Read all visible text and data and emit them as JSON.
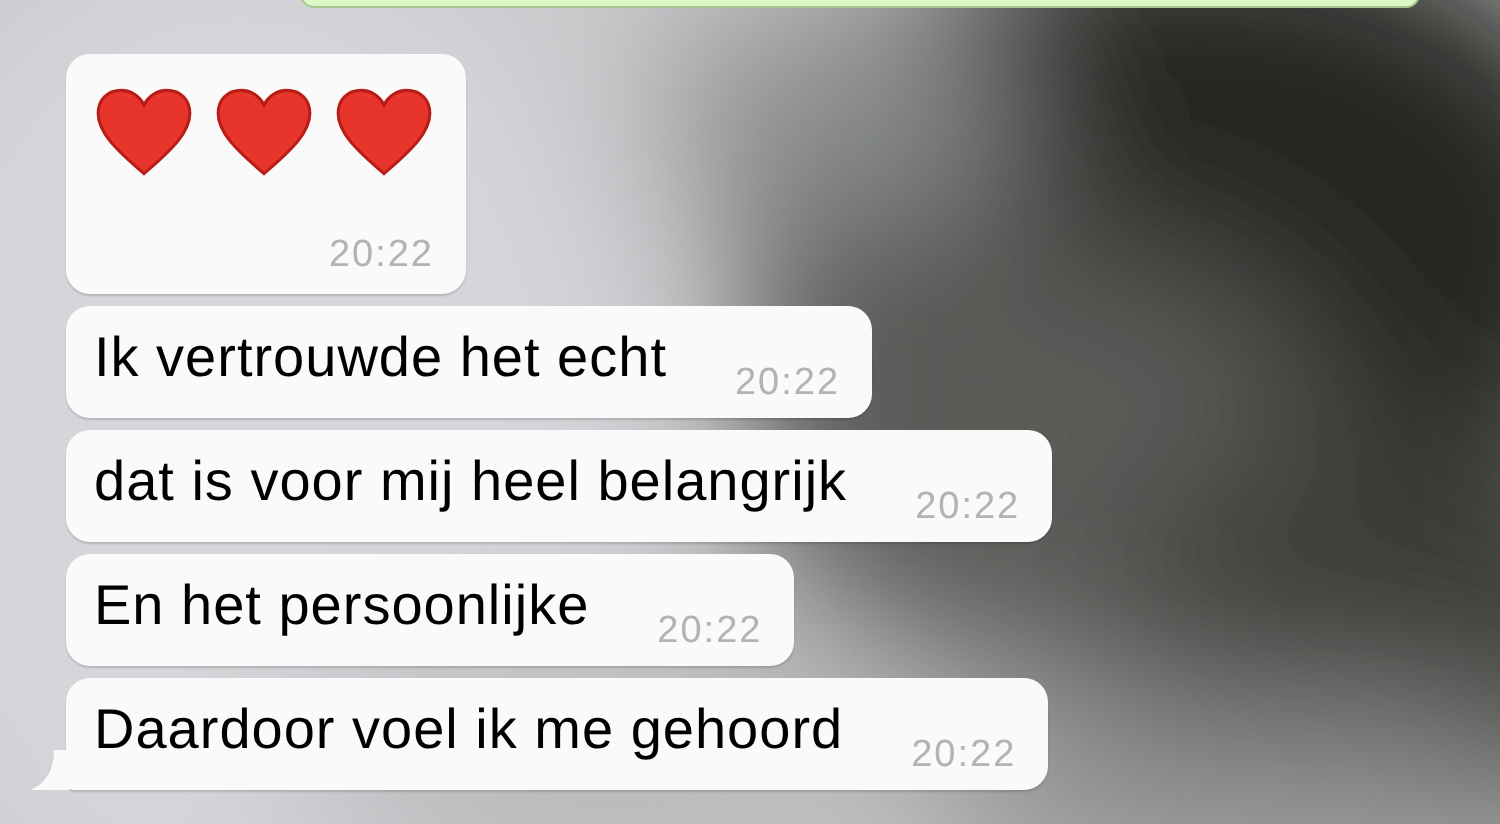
{
  "messages": [
    {
      "kind": "hearts",
      "time": "20:22",
      "tail": false
    },
    {
      "kind": "text",
      "text": "Ik vertrouwde het echt",
      "time": "20:22",
      "tail": false
    },
    {
      "kind": "text",
      "text": "dat is voor mij heel belangrijk",
      "time": "20:22",
      "tail": false
    },
    {
      "kind": "text",
      "text": "En het persoonlijke",
      "time": "20:22",
      "tail": false
    },
    {
      "kind": "text",
      "text": "Daardoor voel ik me gehoord",
      "time": "20:22",
      "tail": true
    }
  ]
}
